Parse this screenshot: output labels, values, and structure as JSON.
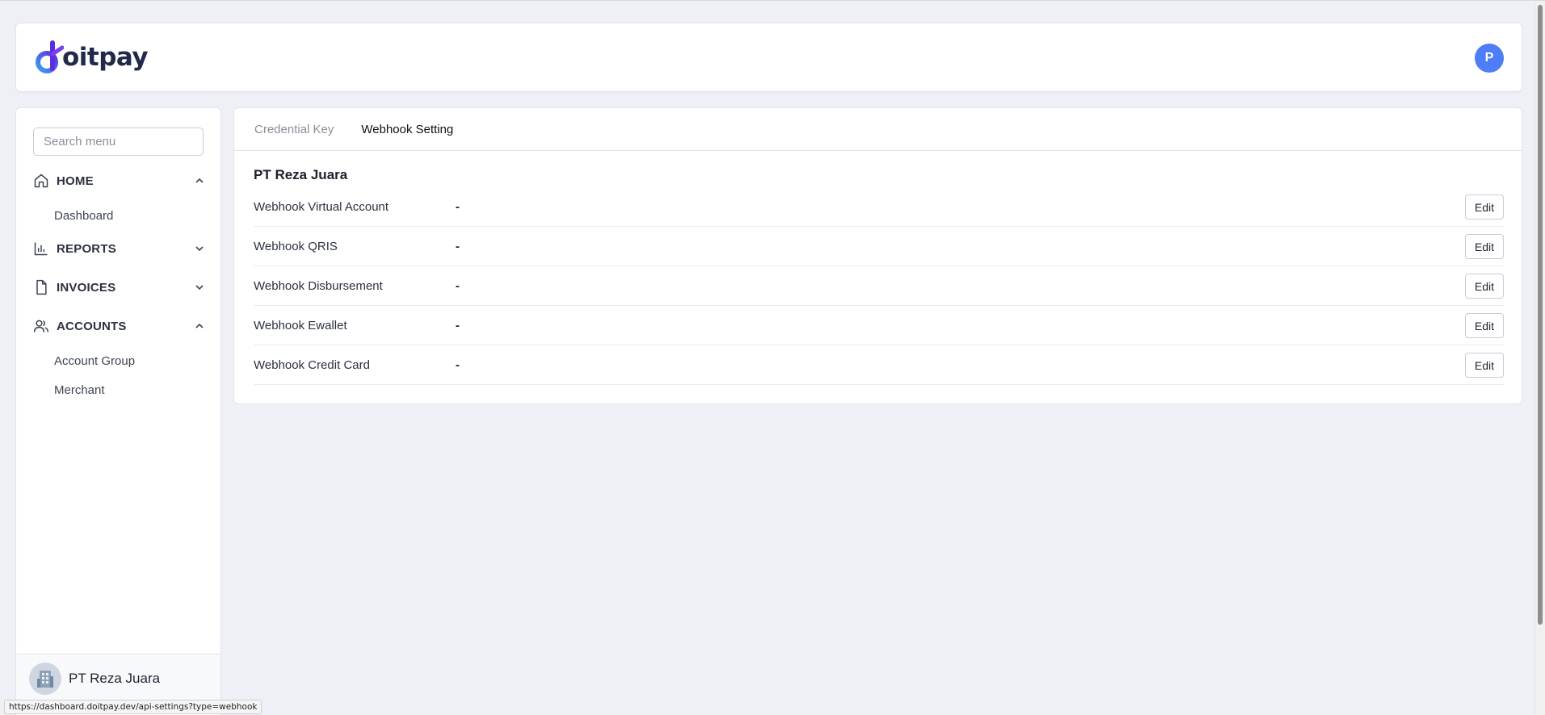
{
  "header": {
    "logo_text": "oitpay",
    "avatar_initial": "P",
    "brand_color": "#4f7cf7"
  },
  "sidebar": {
    "search_placeholder": "Search menu",
    "sections": [
      {
        "label": "HOME",
        "icon": "home-icon",
        "expanded": true,
        "items": [
          "Dashboard"
        ]
      },
      {
        "label": "REPORTS",
        "icon": "bar-chart-icon",
        "expanded": false,
        "items": []
      },
      {
        "label": "INVOICES",
        "icon": "document-icon",
        "expanded": false,
        "items": []
      },
      {
        "label": "ACCOUNTS",
        "icon": "users-icon",
        "expanded": true,
        "items": [
          "Account Group",
          "Merchant"
        ]
      }
    ],
    "footer_name": "PT Reza Juara"
  },
  "tabs": [
    {
      "label": "Credential Key",
      "active": false
    },
    {
      "label": "Webhook Setting",
      "active": true
    }
  ],
  "main": {
    "company": "PT Reza Juara",
    "edit_label": "Edit",
    "rows": [
      {
        "label": "Webhook Virtual Account",
        "value": "-"
      },
      {
        "label": "Webhook QRIS",
        "value": "-"
      },
      {
        "label": "Webhook Disbursement",
        "value": "-"
      },
      {
        "label": "Webhook Ewallet",
        "value": "-"
      },
      {
        "label": "Webhook Credit Card",
        "value": "-"
      }
    ]
  },
  "status_url": "https://dashboard.doitpay.dev/api-settings?type=webhook"
}
